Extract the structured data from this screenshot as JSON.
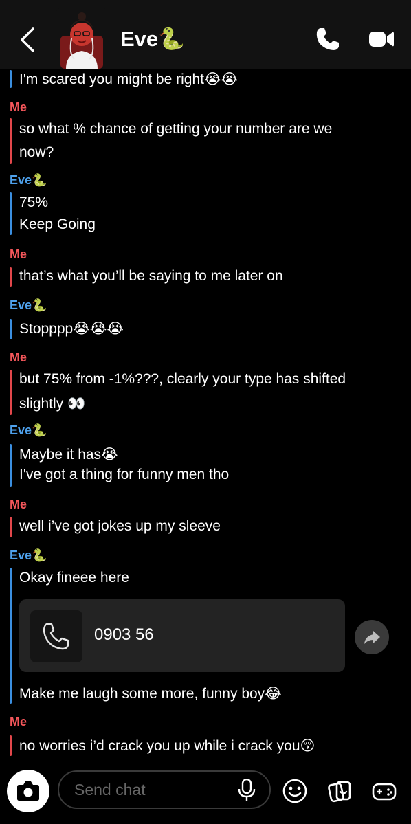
{
  "header": {
    "contact_name": "Eve🐍"
  },
  "icons": {
    "back": "back-arrow-icon",
    "call": "phone-icon",
    "video": "video-camera-icon",
    "share": "share-arrow-icon",
    "camera": "camera-icon",
    "mic": "microphone-icon",
    "emoji": "emoji-icon",
    "stickers": "sticker-icon",
    "games": "game-controller-icon"
  },
  "colors": {
    "me": "#f2565a",
    "eve": "#4ea1ec"
  },
  "messages": [
    {
      "sender": "",
      "lines": [
        "I'm scared you might be right😭😭"
      ]
    },
    {
      "sender": "Me",
      "lines": [
        "so what % chance of getting your number are we",
        "now?"
      ]
    },
    {
      "sender": "Eve🐍",
      "lines": [
        "75%",
        "Keep Going"
      ]
    },
    {
      "sender": "Me",
      "lines": [
        "that’s what you’ll be saying to me later on"
      ]
    },
    {
      "sender": "Eve🐍",
      "lines": [
        "Stopppp😭😭😭"
      ]
    },
    {
      "sender": "Me",
      "lines": [
        "but 75% from -1%???, clearly your type has shifted",
        "slightly 👀"
      ]
    },
    {
      "sender": "Eve🐍",
      "lines": [
        "Maybe it has😭",
        "I've got a thing for funny men tho"
      ]
    },
    {
      "sender": "Me",
      "lines": [
        "well i’ve got jokes up my sleeve"
      ]
    },
    {
      "sender": "Eve🐍",
      "lines": [
        "Okay fineee here"
      ],
      "call_card": {
        "number": "0903 56"
      },
      "after": [
        "Make me laugh some more, funny boy😂"
      ]
    },
    {
      "sender": "Me",
      "lines": [
        "no worries i’d crack you up while i crack you😚"
      ]
    }
  ],
  "composer": {
    "placeholder": "Send chat"
  }
}
